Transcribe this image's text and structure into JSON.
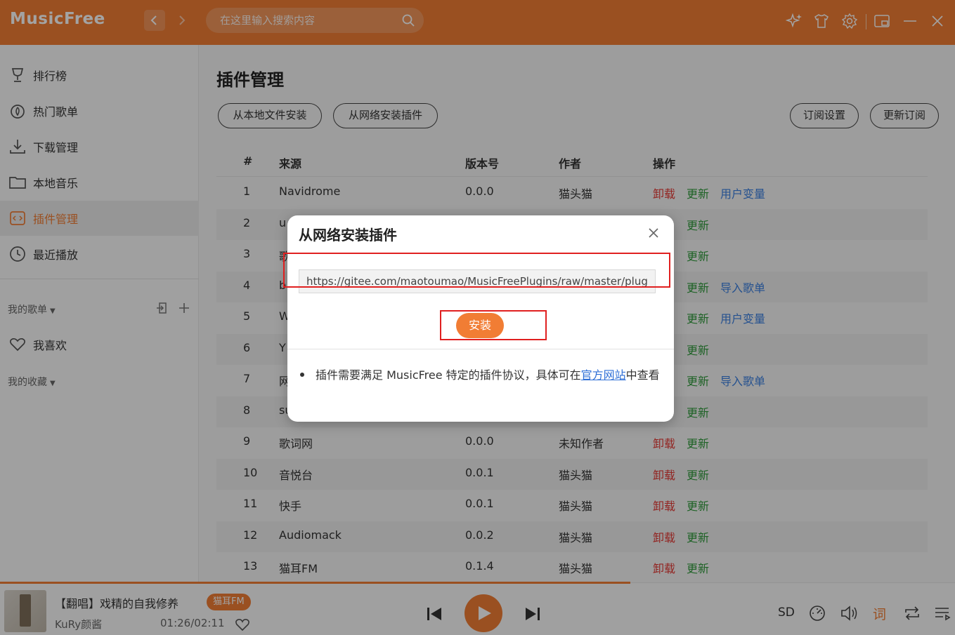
{
  "app": {
    "logo": "MusicFree",
    "search_placeholder": "在这里输入搜索内容",
    "nav": {
      "back_icon": "chevron-left-icon",
      "forward_icon": "chevron-right-icon"
    },
    "toolbar_icons": [
      "sparkle-icon",
      "shirt-icon",
      "gear-icon",
      "mini-mode-icon",
      "minimize-icon",
      "close-icon"
    ],
    "accent_color": "#f17d34"
  },
  "sidebar": {
    "items": [
      {
        "label": "排行榜",
        "icon": "trophy-icon"
      },
      {
        "label": "热门歌单",
        "icon": "hot-playlist-icon"
      },
      {
        "label": "下载管理",
        "icon": "download-icon"
      },
      {
        "label": "本地音乐",
        "icon": "folder-icon"
      },
      {
        "label": "插件管理",
        "icon": "plugin-icon",
        "active": true
      },
      {
        "label": "最近播放",
        "icon": "clock-icon"
      }
    ],
    "my_playlists": "我的歌单",
    "favorite": "我喜欢",
    "my_collections": "我的收藏"
  },
  "main": {
    "title": "插件管理",
    "buttons": {
      "install_local": "从本地文件安装",
      "install_network": "从网络安装插件",
      "subscription_settings": "订阅设置",
      "update_subscription": "更新订阅"
    },
    "columns": [
      "#",
      "来源",
      "版本号",
      "作者",
      "操作"
    ],
    "rows": [
      {
        "idx": "1",
        "source": "Navidrome",
        "version": "0.0.0",
        "author": "猫头猫",
        "ops": [
          "卸载",
          "更新",
          "用户变量"
        ]
      },
      {
        "idx": "2",
        "source": "u",
        "version": "",
        "author": "",
        "ops": [
          "",
          "更新",
          ""
        ]
      },
      {
        "idx": "3",
        "source": "歌",
        "version": "",
        "author": "",
        "ops": [
          "",
          "更新",
          ""
        ]
      },
      {
        "idx": "4",
        "source": "b",
        "version": "",
        "author": "",
        "ops": [
          "",
          "更新",
          "导入歌单"
        ]
      },
      {
        "idx": "5",
        "source": "W",
        "version": "",
        "author": "",
        "ops": [
          "",
          "更新",
          "用户变量"
        ]
      },
      {
        "idx": "6",
        "source": "Y",
        "version": "",
        "author": "",
        "ops": [
          "",
          "更新",
          ""
        ]
      },
      {
        "idx": "7",
        "source": "网",
        "version": "",
        "author": "",
        "ops": [
          "",
          "更新",
          "导入歌单"
        ]
      },
      {
        "idx": "8",
        "source": "su",
        "version": "",
        "author": "",
        "ops": [
          "",
          "更新",
          ""
        ]
      },
      {
        "idx": "9",
        "source": "歌词网",
        "version": "0.0.0",
        "author": "未知作者",
        "ops": [
          "卸载",
          "更新",
          ""
        ]
      },
      {
        "idx": "10",
        "source": "音悦台",
        "version": "0.0.1",
        "author": "猫头猫",
        "ops": [
          "卸载",
          "更新",
          ""
        ]
      },
      {
        "idx": "11",
        "source": "快手",
        "version": "0.0.1",
        "author": "猫头猫",
        "ops": [
          "卸载",
          "更新",
          ""
        ]
      },
      {
        "idx": "12",
        "source": "Audiomack",
        "version": "0.0.2",
        "author": "猫头猫",
        "ops": [
          "卸载",
          "更新",
          ""
        ]
      },
      {
        "idx": "13",
        "source": "猫耳FM",
        "version": "0.1.4",
        "author": "猫头猫",
        "ops": [
          "卸载",
          "更新",
          ""
        ]
      }
    ]
  },
  "modal": {
    "title": "从网络安装插件",
    "url_value": "https://gitee.com/maotoumao/MusicFreePlugins/raw/master/plug",
    "install_label": "安装",
    "note_prefix": "插件需要满足 MusicFree 特定的插件协议，具体可在",
    "note_link": "官方网站",
    "note_suffix": "中查看"
  },
  "player": {
    "song_title": "【翻唱】戏精的自我修养",
    "source_badge": "猫耳FM",
    "artist": "KuRy颜酱",
    "time": "01:26/02:11",
    "progress": 0.66,
    "quality": "SD",
    "lyric_label": "词"
  }
}
